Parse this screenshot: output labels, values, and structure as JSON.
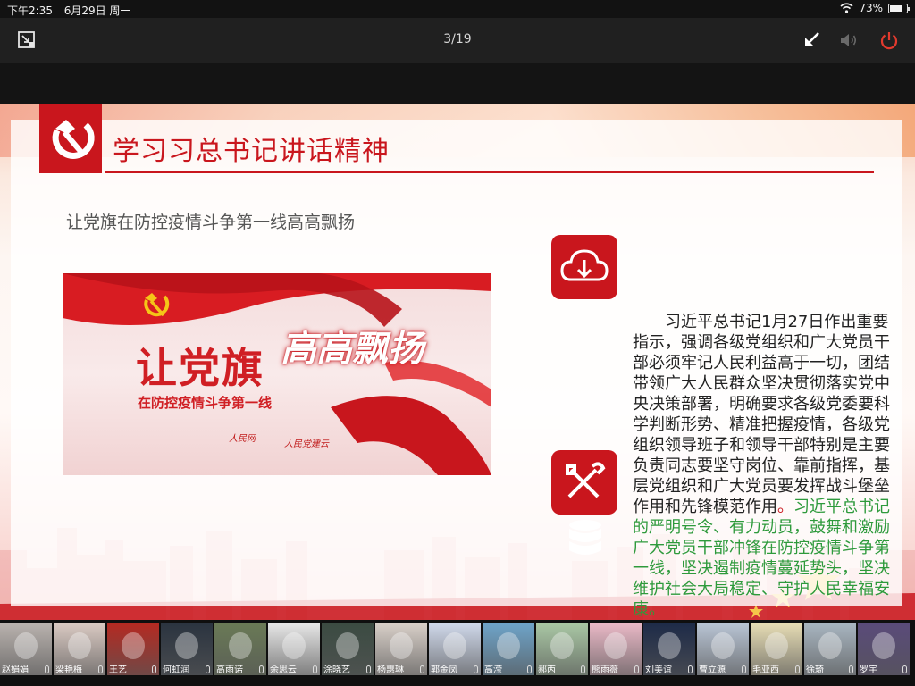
{
  "status_bar": {
    "time": "下午2:35",
    "date": "6月29日 周一",
    "battery": "73%",
    "battery_level": 0.73
  },
  "toolbar": {
    "page_counter": "3/19",
    "icons": [
      "screen-switch-icon",
      "minimize-arrow-icon",
      "volume-icon",
      "power-icon"
    ]
  },
  "slide": {
    "title": "学习习总书记讲话精神",
    "subtitle": "让党旗在防控疫情斗争第一线高高飘扬",
    "banner": {
      "main_text": "让党旗",
      "sub_text": "在防控疫情斗争第一线",
      "script_text": "高高飘扬",
      "brand_1": "人民网",
      "brand_2": "人民党建云"
    },
    "body_text_black": "习近平总书记1月27日作出重要指示，强调各级党组织和广大党员干部必须牢记人民利益高于一切，团结带领广大人民群众坚决贯彻落实党中央决策部署，明确要求各级党委要科学判断形势、精准把握疫情，各级党组织领导班子和领导干部特别是主要负责同志要坚守岗位、靠前指挥，基层党组织和广大党员要发挥战斗堡垒作用和先锋模范作用",
    "body_text_dot": "。",
    "body_text_green": "习近平总书记的严明号令、有力动员，鼓舞和激励广大党员干部冲锋在防控疫情斗争第一线，坚决遏制疫情蔓延势头，坚决维护社会大局稳定、守护人民幸福安康。",
    "icons": [
      "cloud-download-icon",
      "tools-icon",
      "database-icon",
      "hammer-sickle-icon"
    ]
  },
  "colors": {
    "party_red": "#c9161d",
    "green_text": "#2e9a3c"
  },
  "participants": [
    {
      "name": "赵娟娟",
      "color": "#b9b2ae"
    },
    {
      "name": "梁艳梅",
      "color": "#d9c9c2"
    },
    {
      "name": "王艺",
      "color": "#b42a22"
    },
    {
      "name": "何虹润",
      "color": "#2b3440"
    },
    {
      "name": "高雨诺",
      "color": "#6a7a56"
    },
    {
      "name": "余思云",
      "color": "#e6e6e6"
    },
    {
      "name": "涂晓艺",
      "color": "#3b4b42"
    },
    {
      "name": "杨惠琳",
      "color": "#d8cfc8"
    },
    {
      "name": "郭金凤",
      "color": "#cfd8ea"
    },
    {
      "name": "高滢",
      "color": "#6ea3c8"
    },
    {
      "name": "郝丙",
      "color": "#a9c7a4"
    },
    {
      "name": "熊雨薇",
      "color": "#e9b8c6"
    },
    {
      "name": "刘美谊",
      "color": "#1e2b48"
    },
    {
      "name": "曹立源",
      "color": "#b8c4d4"
    },
    {
      "name": "毛亚西",
      "color": "#e6dcb4"
    },
    {
      "name": "徐琦",
      "color": "#a8b5c0"
    },
    {
      "name": "罗宇",
      "color": "#5a4b7a"
    }
  ]
}
